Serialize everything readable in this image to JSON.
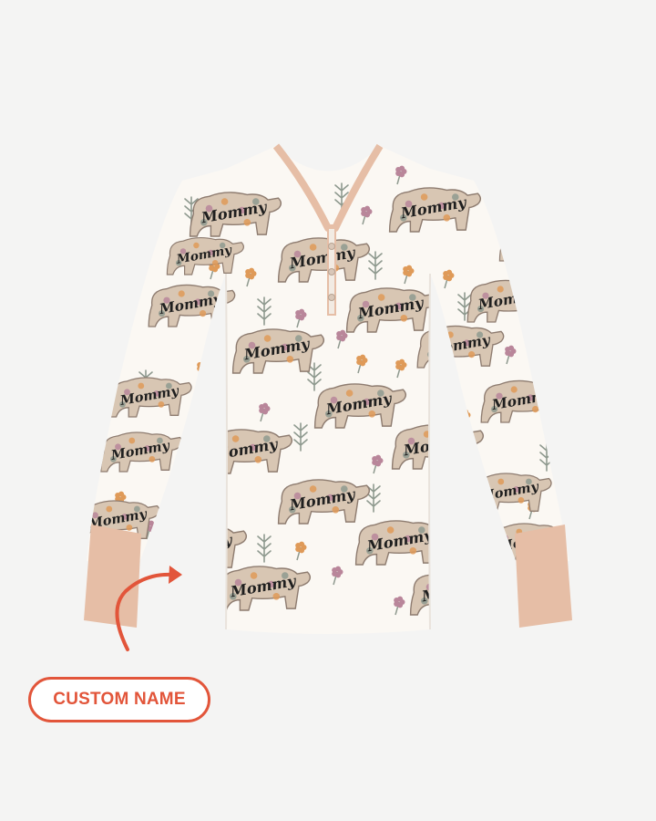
{
  "product": {
    "name": "Mommy bear floral pajama top",
    "print_text": "Mommy",
    "colors": {
      "background": "#f4f4f3",
      "fabric": "#fbf8f3",
      "trim": "#e6bea6",
      "button": "#d9c7b8",
      "bear_fill": "#d8c6b3",
      "bear_outline": "#8e7c70",
      "flower_pink": "#b9869a",
      "flower_orange": "#df9a58",
      "leaf": "#8f9a8f",
      "text": "#1f1f1f"
    }
  },
  "callout": {
    "label": "CUSTOM NAME",
    "color": "#e2553a",
    "arrow_icon": "curved-arrow-icon"
  }
}
